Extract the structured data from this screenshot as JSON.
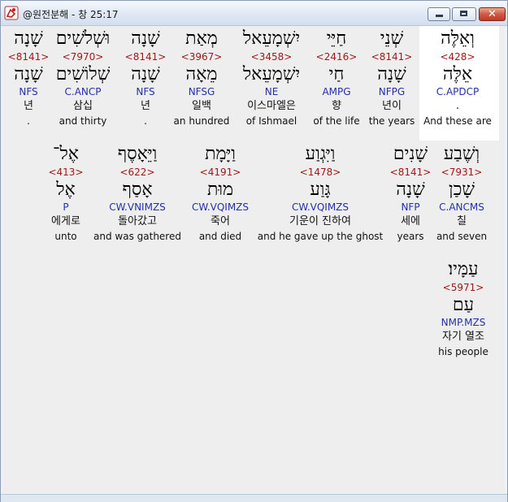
{
  "window": {
    "title": "@원전분해 - 창 25:17",
    "close_glyph": "✕"
  },
  "row1": [
    {
      "word": "וְאֵלֶּה",
      "strong": "<428>",
      "lemma": "אֵלֶּה",
      "morph": "C.APDCP",
      "korean": ".",
      "english": "And these are"
    },
    {
      "word": "שְׁנֵי",
      "strong": "<8141>",
      "lemma": "שָׁנָה",
      "morph": "NFPG",
      "korean": "년이",
      "english": "the years"
    },
    {
      "word": "חַיֵּי",
      "strong": "<2416>",
      "lemma": "חַי",
      "morph": "AMPG",
      "korean": "향",
      "english": "of the life"
    },
    {
      "word": "יִשְׁמָעֵאל",
      "strong": "<3458>",
      "lemma": "יִשְׁמָעֵאל",
      "morph": "NE",
      "korean": "이스마엘은",
      "english": "of Ishmael"
    },
    {
      "word": "מְאַת",
      "strong": "<3967>",
      "lemma": "מֵאָה",
      "morph": "NFSG",
      "korean": "일백",
      "english": "an hundred"
    },
    {
      "word": "שָׁנָה",
      "strong": "<8141>",
      "lemma": "שָׁנָה",
      "morph": "NFS",
      "korean": "년",
      "english": "."
    },
    {
      "word": "וּשְׁלֹשִׁים",
      "strong": "<7970>",
      "lemma": "שְׁלוֹשִׁים",
      "morph": "C.ANCP",
      "korean": "삼십",
      "english": "and thirty"
    },
    {
      "word": "שָׁנָה",
      "strong": "<8141>",
      "lemma": "שָׁנָה",
      "morph": "NFS",
      "korean": "년",
      "english": "."
    }
  ],
  "row2": [
    {
      "word": "וְשֶׁבַע",
      "strong": "<7931>",
      "lemma": "שָׁכַן",
      "morph": "C.ANCMS",
      "korean": "칠",
      "english": "and seven"
    },
    {
      "word": "שָׁנִים",
      "strong": "<8141>",
      "lemma": "שָׁנָה",
      "morph": "NFP",
      "korean": "세에",
      "english": "years"
    },
    {
      "word": "וַיִּגְוַע",
      "strong": "<1478>",
      "lemma": "גָּוַע",
      "morph": "CW.VQIMZS",
      "korean": "기운이 진하여",
      "english": "and he gave up the ghost"
    },
    {
      "word": "וַיָּמָת",
      "strong": "<4191>",
      "lemma": "מוּת",
      "morph": "CW.VQIMZS",
      "korean": "죽어",
      "english": "and died"
    },
    {
      "word": "וַיֵּאָסֶף",
      "strong": "<622>",
      "lemma": "אָסַף",
      "morph": "CW.VNIMZS",
      "korean": "돌아갔고",
      "english": "and was gathered"
    },
    {
      "word": "אֶל־",
      "strong": "<413>",
      "lemma": "אֶל",
      "morph": "P",
      "korean": "에게로",
      "english": "unto"
    }
  ],
  "row3": [
    {
      "word": "עַמָּיו׃",
      "strong": "<5971>",
      "lemma": "עַם",
      "morph": "NMP.MZS",
      "korean": "자기 열조",
      "english": "his people"
    }
  ],
  "colors": {
    "strong": "#a01818",
    "morph": "#2330a8",
    "selected_background": "#ffffff",
    "content_background": "#eeeeee"
  },
  "icons": {
    "app": "bible-analysis-icon",
    "minimize": "minimize-icon",
    "maximize": "maximize-icon",
    "close": "close-icon"
  }
}
